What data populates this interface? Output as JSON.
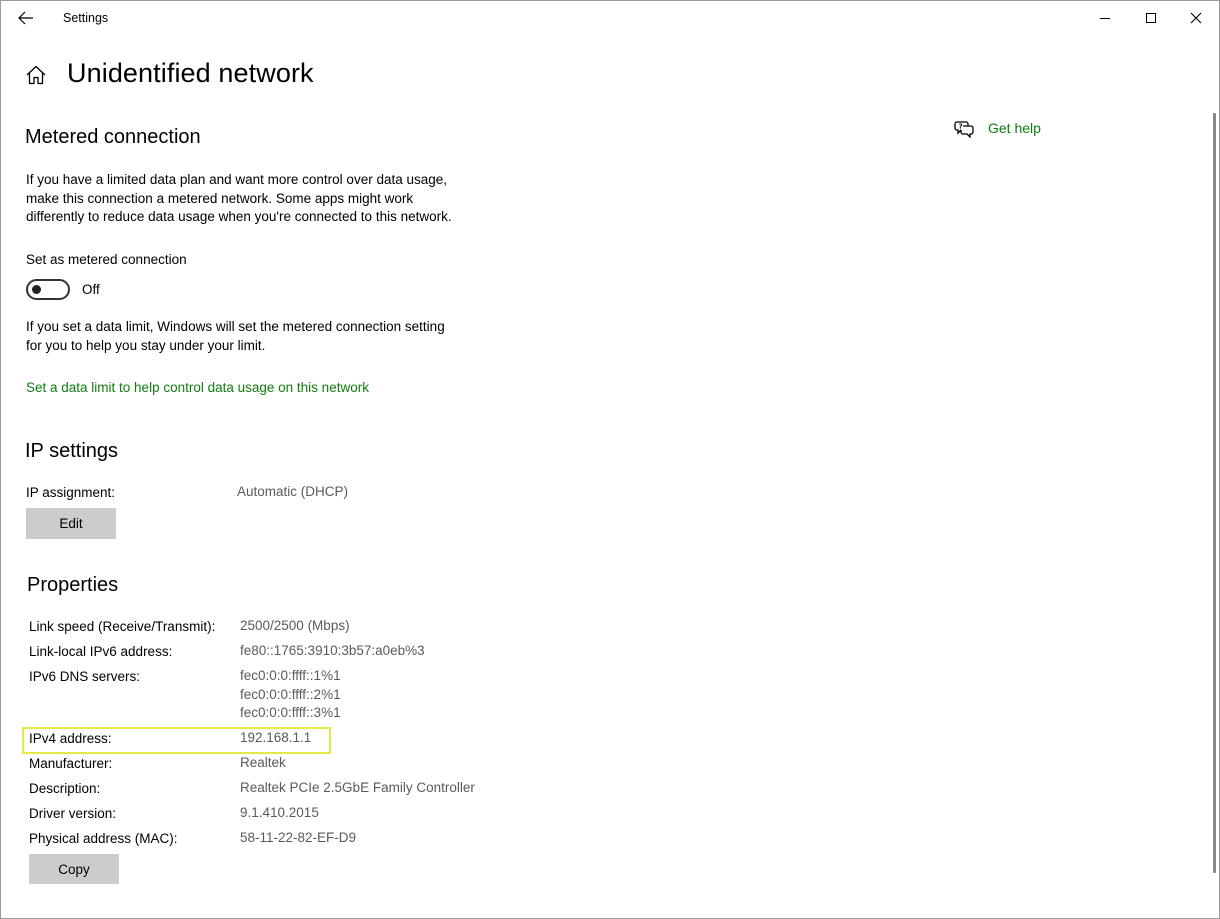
{
  "window": {
    "title": "Settings"
  },
  "page": {
    "title": "Unidentified network"
  },
  "help": {
    "label": "Get help"
  },
  "metered": {
    "heading": "Metered connection",
    "description_lines": [
      "If you have a limited data plan and want more control over data usage,",
      "make this connection a metered network. Some apps might work",
      "differently to reduce data usage when you're connected to this network."
    ],
    "toggle_label": "Set as metered connection",
    "toggle_state": "Off",
    "toggle_on": false,
    "limit_lines": [
      "If you set a data limit, Windows will set the metered connection setting",
      "for you to help you stay under your limit."
    ],
    "limit_link": "Set a data limit to help control data usage on this network"
  },
  "ip_settings": {
    "heading": "IP settings",
    "assignment_label": "IP assignment:",
    "assignment_value": "Automatic (DHCP)",
    "edit_button": "Edit"
  },
  "properties": {
    "heading": "Properties",
    "rows": [
      {
        "label": "Link speed (Receive/Transmit):",
        "values": [
          "2500/2500 (Mbps)"
        ]
      },
      {
        "label": "Link-local IPv6 address:",
        "values": [
          "fe80::1765:3910:3b57:a0eb%3"
        ]
      },
      {
        "label": "IPv6 DNS servers:",
        "values": [
          "fec0:0:0:ffff::1%1",
          "fec0:0:0:ffff::2%1",
          "fec0:0:0:ffff::3%1"
        ]
      },
      {
        "label": "IPv4 address:",
        "values": [
          "192.168.1.1"
        ]
      },
      {
        "label": "Manufacturer:",
        "values": [
          "Realtek"
        ]
      },
      {
        "label": "Description:",
        "values": [
          "Realtek PCIe 2.5GbE Family Controller"
        ]
      },
      {
        "label": "Driver version:",
        "values": [
          "9.1.410.2015"
        ]
      },
      {
        "label": "Physical address (MAC):",
        "values": [
          "58-11-22-82-EF-D9"
        ]
      }
    ],
    "copy_button": "Copy"
  },
  "colors": {
    "accent": "#107c10",
    "highlight": "#e6e84a"
  },
  "icons": [
    "back-arrow-icon",
    "minimize-icon",
    "maximize-icon",
    "close-icon",
    "home-icon",
    "get-help-icon"
  ]
}
